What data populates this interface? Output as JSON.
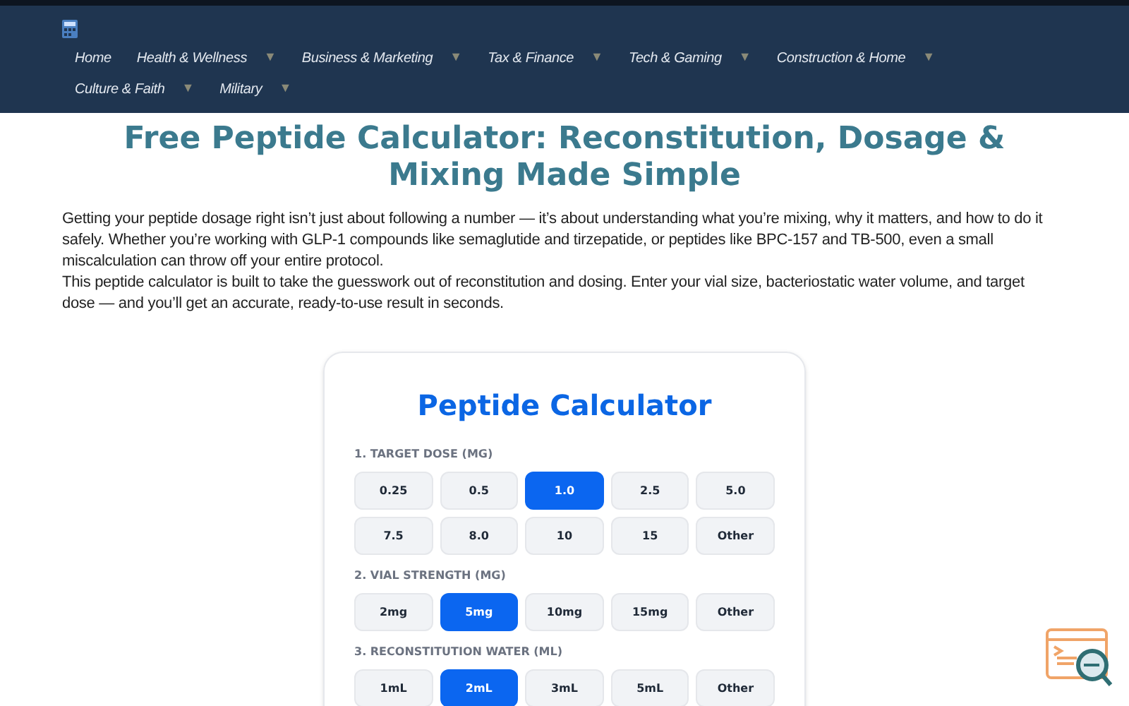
{
  "nav": [
    {
      "label": "Home",
      "dropdown": false
    },
    {
      "label": "Health & Wellness",
      "dropdown": true
    },
    {
      "label": "Business & Marketing",
      "dropdown": true
    },
    {
      "label": "Tax & Finance",
      "dropdown": true
    },
    {
      "label": "Tech & Gaming",
      "dropdown": true
    },
    {
      "label": "Construction & Home",
      "dropdown": true
    },
    {
      "label": "Culture & Faith",
      "dropdown": true
    },
    {
      "label": "Military",
      "dropdown": true
    }
  ],
  "nav_arrow": "▼",
  "title": "Free Peptide Calculator: Reconstitution, Dosage & Mixing Made Simple",
  "intro": [
    "Getting your peptide dosage right isn’t just about following a number — it’s about understanding what you’re mixing, why it matters, and how to do it safely. Whether you’re working with GLP-1 compounds like semaglutide and tirzepatide, or peptides like BPC-157 and TB-500, even a small miscalculation can throw off your entire protocol.",
    "This peptide calculator is built to take the guesswork out of reconstitution and dosing. Enter your vial size, bacteriostatic water volume, and target dose — and you’ll get an accurate, ready-to-use result in seconds."
  ],
  "calculator": {
    "title": "Peptide Calculator",
    "sections": [
      {
        "label": "1. TARGET DOSE (MG)",
        "options": [
          {
            "label": "0.25",
            "selected": false
          },
          {
            "label": "0.5",
            "selected": false
          },
          {
            "label": "1.0",
            "selected": true
          },
          {
            "label": "2.5",
            "selected": false
          },
          {
            "label": "5.0",
            "selected": false
          },
          {
            "label": "7.5",
            "selected": false
          },
          {
            "label": "8.0",
            "selected": false
          },
          {
            "label": "10",
            "selected": false
          },
          {
            "label": "15",
            "selected": false
          },
          {
            "label": "Other",
            "selected": false
          }
        ]
      },
      {
        "label": "2. VIAL STRENGTH (MG)",
        "options": [
          {
            "label": "2mg",
            "selected": false
          },
          {
            "label": "5mg",
            "selected": true
          },
          {
            "label": "10mg",
            "selected": false
          },
          {
            "label": "15mg",
            "selected": false
          },
          {
            "label": "Other",
            "selected": false
          }
        ]
      },
      {
        "label": "3. RECONSTITUTION WATER (ML)",
        "options": [
          {
            "label": "1mL",
            "selected": false
          },
          {
            "label": "2mL",
            "selected": true
          },
          {
            "label": "3mL",
            "selected": false
          },
          {
            "label": "5mL",
            "selected": false
          },
          {
            "label": "Other",
            "selected": false
          }
        ]
      }
    ]
  }
}
